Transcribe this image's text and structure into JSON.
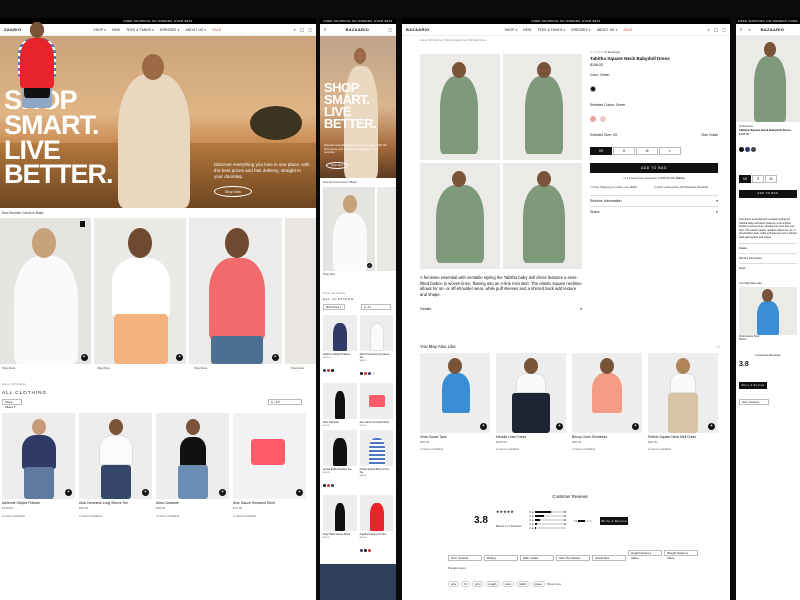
{
  "promo": "FREE SHIPPING ON ORDERS OVER $200",
  "brand": {
    "name_a": "ZAARIO",
    "name_b": "BAZAARIO"
  },
  "nav": {
    "items": [
      "SHOP ▾",
      "NEW",
      "TEES & TANKS ▾",
      "DRESSES ▾",
      "ABOUT US ▾",
      "SALE"
    ]
  },
  "hero": {
    "line1": "SHOP",
    "line2": "SMART.",
    "line3": "LIVE",
    "line4": "BETTER.",
    "subtitle": "Discover everything you love in one place, with the best prices and fast delivery, straight to your doorstep.",
    "cta": "Shop Now"
  },
  "listing": {
    "arrivals_label": "New Summer Colors In Basic",
    "featured": [
      "Shop Now",
      "Shop Now",
      "Shop Now",
      "Shop Now"
    ],
    "breadcrumb": "Home / All Clothing",
    "heading": "ALL CLOTHING",
    "filter_label": "Show Filters ▾",
    "sort_label": "A - Z ▾",
    "products": [
      {
        "name": "Adrienne Striped Pullover",
        "price": "$128.00",
        "note": "4 colors available"
      },
      {
        "name": "Alda Crewneck Long Sleeve Tee",
        "price": "$68.00",
        "note": "2 colors available"
      },
      {
        "name": "Alina Camisole",
        "price": "$58.00",
        "note": "4 colors available"
      },
      {
        "name": "Aloe Gauze Smocked Short",
        "price": "$74.00",
        "note": "2 colors available"
      }
    ]
  },
  "mobile_list": {
    "products": [
      {
        "name": "Adrienne Striped Pullover",
        "price": "$128.00"
      },
      {
        "name": "Alda Crewneck Long Sleeve Tee",
        "price": "$68.00"
      },
      {
        "name": "Alina Camisole",
        "price": "$58.00"
      },
      {
        "name": "Aloe Gauze Smocked Short",
        "price": "$74.00"
      },
      {
        "name": "Amara Ruffle Shoulder Tee",
        "price": "$58.00"
      },
      {
        "name": "Amelie Striped Button Front Tee",
        "price": "$88.00"
      },
      {
        "name": "Andy Halter Gauze Dress",
        "price": "$98.00"
      },
      {
        "name": "Angelina Henley Knit Tee",
        "price": "$68.00"
      }
    ]
  },
  "pdp": {
    "breadcrumb": "Home / All Clothing / Tabitha Square Neck Babydoll Dress",
    "reviews": "(0 Reviews)",
    "title": "Tabitha Square Neck Babydoll Dress",
    "price": "$158.00",
    "color_label": "Color: Green",
    "color_label_2": "Selected Colors: Green",
    "size_label": "Selected Size: XS",
    "size_guide": "Size Guide",
    "sizes": [
      "XS",
      "S",
      "M",
      "L"
    ],
    "add_to_bag": "ADD TO BAG",
    "installments": "or 4 interest-free payments of $39.50 with",
    "klarna": "Klarna",
    "ship1": "Free Shipping on orders over $200",
    "ship2": "Earn extra points with Bazaario Rewards",
    "returns": "Returns Information",
    "share": "Share",
    "description": "A feminine essential with versatile styling the Tabitha baby doll dress features a semi-fitted bodice in woven linen, flowing into an A-line mini skirt. The elastic square neckline allows for on- or off-shoulder wear, while puff sleeves and a shirred back add texture and shape.",
    "details": "Details",
    "you_may_like": "You May Also Like",
    "related": [
      {
        "name": "Viola Gauze Tank",
        "price": "$48.00",
        "note": "3 colors available"
      },
      {
        "name": "Meadia Linen Dress",
        "price": "$128.00",
        "note": "2 colors available"
      },
      {
        "name": "Briony Linen Shirtdress",
        "price": "$88.00",
        "note": "3 colors available"
      },
      {
        "name": "Pebble Square Neck Midi Dress",
        "price": "$98.00",
        "note": "3 colors available"
      }
    ],
    "review_title": "Customer Reviews",
    "rating": "3.8",
    "rating_stars": "★★★★★",
    "rating_note": "Based on 4 Reviews",
    "breakdown": [
      {
        "stars": "5 ★",
        "pct": 0.6,
        "count": "58"
      },
      {
        "stars": "4 ★",
        "pct": 0.35,
        "count": "36"
      },
      {
        "stars": "3 ★",
        "pct": 0.2,
        "count": "24"
      },
      {
        "stars": "2 ★",
        "pct": 0.1,
        "count": "10"
      },
      {
        "stars": "1 ★",
        "pct": 0.05,
        "count": "4"
      }
    ],
    "write_review": "Write A Review",
    "review_filters": [
      "Sort: Newest",
      "Rating",
      "With media",
      "Size Purchased",
      "Usual Size",
      "Height Select a Value",
      "Weight Select a Value"
    ],
    "popular_label": "Popular topics",
    "popular_topics": [
      "size",
      "fit",
      "print",
      "length",
      "color",
      "fabric",
      "dress"
    ],
    "show_more": "Show more",
    "fit_label": "Fit"
  },
  "mobile_pdp": {
    "rating": "3.8",
    "write_review": "Write A Review",
    "sort": "Sort: Newest",
    "related_name": "Viola Gauze Tank",
    "related_price": "$48.00"
  },
  "colors": {
    "green": "#7f9a7a",
    "swatch1": "#e7a5a0",
    "swatch2": "#f1c7c4",
    "ink": "#111111",
    "sale": "#d33333"
  }
}
